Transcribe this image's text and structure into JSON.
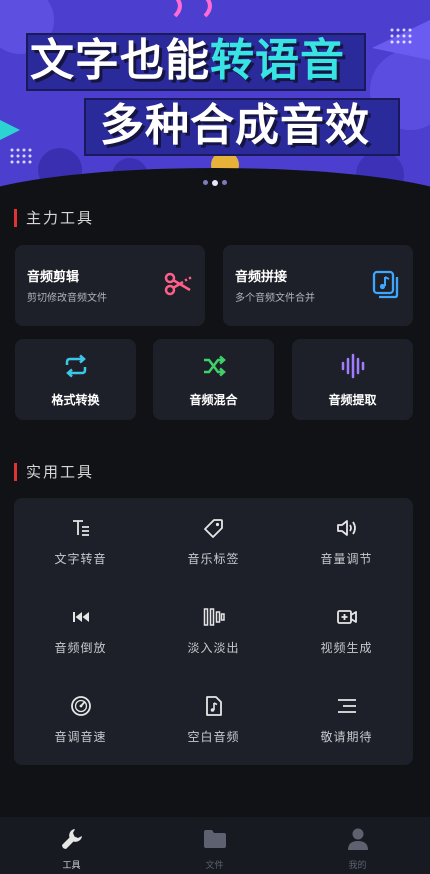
{
  "banner": {
    "line1_plain": "文字也能",
    "line1_accent": "转语音",
    "line2": "多种合成音效",
    "carousel_pages": 3,
    "carousel_active": 1
  },
  "main_section": {
    "title": "主力工具"
  },
  "main_tools": [
    {
      "name": "音频剪辑",
      "desc": "剪切修改音频文件",
      "icon": "scissors-icon",
      "color": "#ff5f8a"
    },
    {
      "name": "音频拼接",
      "desc": "多个音频文件合并",
      "icon": "music-file-stack-icon",
      "color": "#3ea6ff"
    }
  ],
  "small_tools": [
    {
      "name": "格式转换",
      "icon": "repeat-icon",
      "color": "#3ec6e8"
    },
    {
      "name": "音频混合",
      "icon": "shuffle-icon",
      "color": "#3fd06a"
    },
    {
      "name": "音频提取",
      "icon": "soundwave-icon",
      "color": "#a27cff"
    }
  ],
  "util_section": {
    "title": "实用工具"
  },
  "util_tools": [
    {
      "name": "文字转音",
      "icon": "text-to-speech-icon"
    },
    {
      "name": "音乐标签",
      "icon": "tag-icon"
    },
    {
      "name": "音量调节",
      "icon": "volume-icon"
    },
    {
      "name": "音频倒放",
      "icon": "rewind-icon"
    },
    {
      "name": "淡入淡出",
      "icon": "fade-icon"
    },
    {
      "name": "视频生成",
      "icon": "video-plus-icon"
    },
    {
      "name": "音调音速",
      "icon": "speed-dial-icon"
    },
    {
      "name": "空白音频",
      "icon": "blank-audio-file-icon"
    },
    {
      "name": "敬请期待",
      "icon": "coming-soon-icon"
    }
  ],
  "nav": [
    {
      "label": "工具",
      "icon": "wrench-icon",
      "active": true
    },
    {
      "label": "文件",
      "icon": "folder-icon",
      "active": false
    },
    {
      "label": "我的",
      "icon": "user-icon",
      "active": false
    }
  ],
  "colors": {
    "background": "#101216",
    "card": "#1d2028",
    "section_bar": "#e03434",
    "banner_bg": "#4c3fd0",
    "banner_accent": "#38e3e3"
  }
}
